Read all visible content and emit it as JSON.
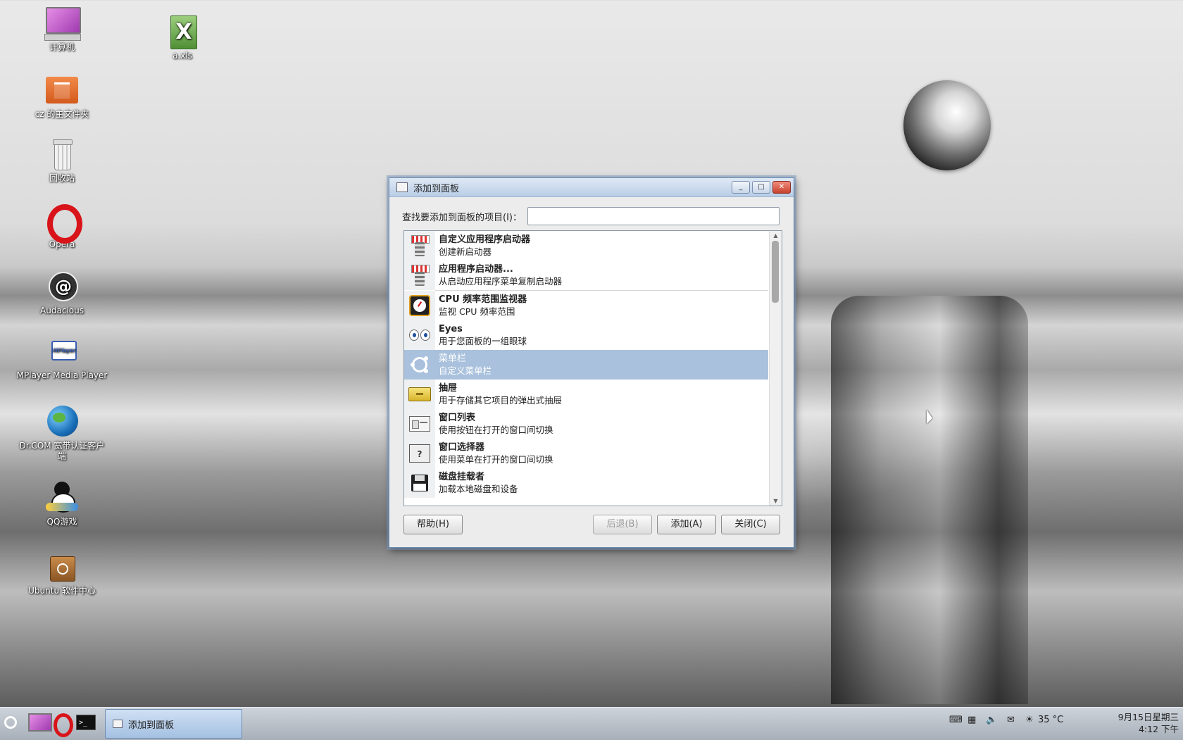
{
  "desktop": {
    "icons": [
      {
        "label": "计算机",
        "icon": "computer-icon"
      },
      {
        "label": "a.xls",
        "icon": "spreadsheet-icon"
      },
      {
        "label": "cz 的主文件夹",
        "icon": "home-folder-icon"
      },
      {
        "label": "回收站",
        "icon": "trash-icon"
      },
      {
        "label": "Opera",
        "icon": "opera-icon"
      },
      {
        "label": "Audacious",
        "icon": "audacious-icon"
      },
      {
        "label": "MPlayer Media Player",
        "icon": "mplayer-icon"
      },
      {
        "label": "Dr.COM 宽带认证客户端",
        "icon": "drcom-globe-icon"
      },
      {
        "label": "QQ游戏",
        "icon": "qq-game-icon"
      },
      {
        "label": "Ubuntu 软件中心",
        "icon": "ubuntu-software-center-icon"
      }
    ]
  },
  "dialog": {
    "title": "添加到面板",
    "search_label": "查找要添加到面板的项目(I)：",
    "search_value": "",
    "items": [
      {
        "title": "自定义应用程序启动器",
        "desc": "创建新启动器",
        "icon": "launcher-icon"
      },
      {
        "title": "应用程序启动器...",
        "desc": "从启动应用程序菜单复制启动器",
        "icon": "launcher-icon"
      },
      {
        "title": "CPU 频率范围监视器",
        "desc": "监视 CPU 频率范围",
        "icon": "cpu-frequency-icon"
      },
      {
        "title": "Eyes",
        "desc": "用于您面板的一组眼球",
        "icon": "eyes-icon"
      },
      {
        "title": "菜单栏",
        "desc": "自定义菜单栏",
        "icon": "ubuntu-logo-icon",
        "selected": true
      },
      {
        "title": "抽屉",
        "desc": "用于存储其它项目的弹出式抽屉",
        "icon": "drawer-icon"
      },
      {
        "title": "窗口列表",
        "desc": "使用按钮在打开的窗口间切换",
        "icon": "window-list-icon"
      },
      {
        "title": "窗口选择器",
        "desc": "使用菜单在打开的窗口间切换",
        "icon": "window-selector-icon"
      },
      {
        "title": "磁盘挂载者",
        "desc": "加载本地磁盘和设备",
        "icon": "floppy-disk-icon"
      }
    ],
    "buttons": {
      "help": "帮助(H)",
      "back": "后退(B)",
      "add": "添加(A)",
      "close": "关闭(C)"
    }
  },
  "taskbar": {
    "window_button": "添加到面板",
    "weather": "35 °C",
    "clock_date": "9月15日星期三",
    "clock_time": "4:12 下午"
  },
  "colors": {
    "selection": "#a9c1dc",
    "titlebar": "#b9cde6",
    "close_button": "#c8402d"
  }
}
